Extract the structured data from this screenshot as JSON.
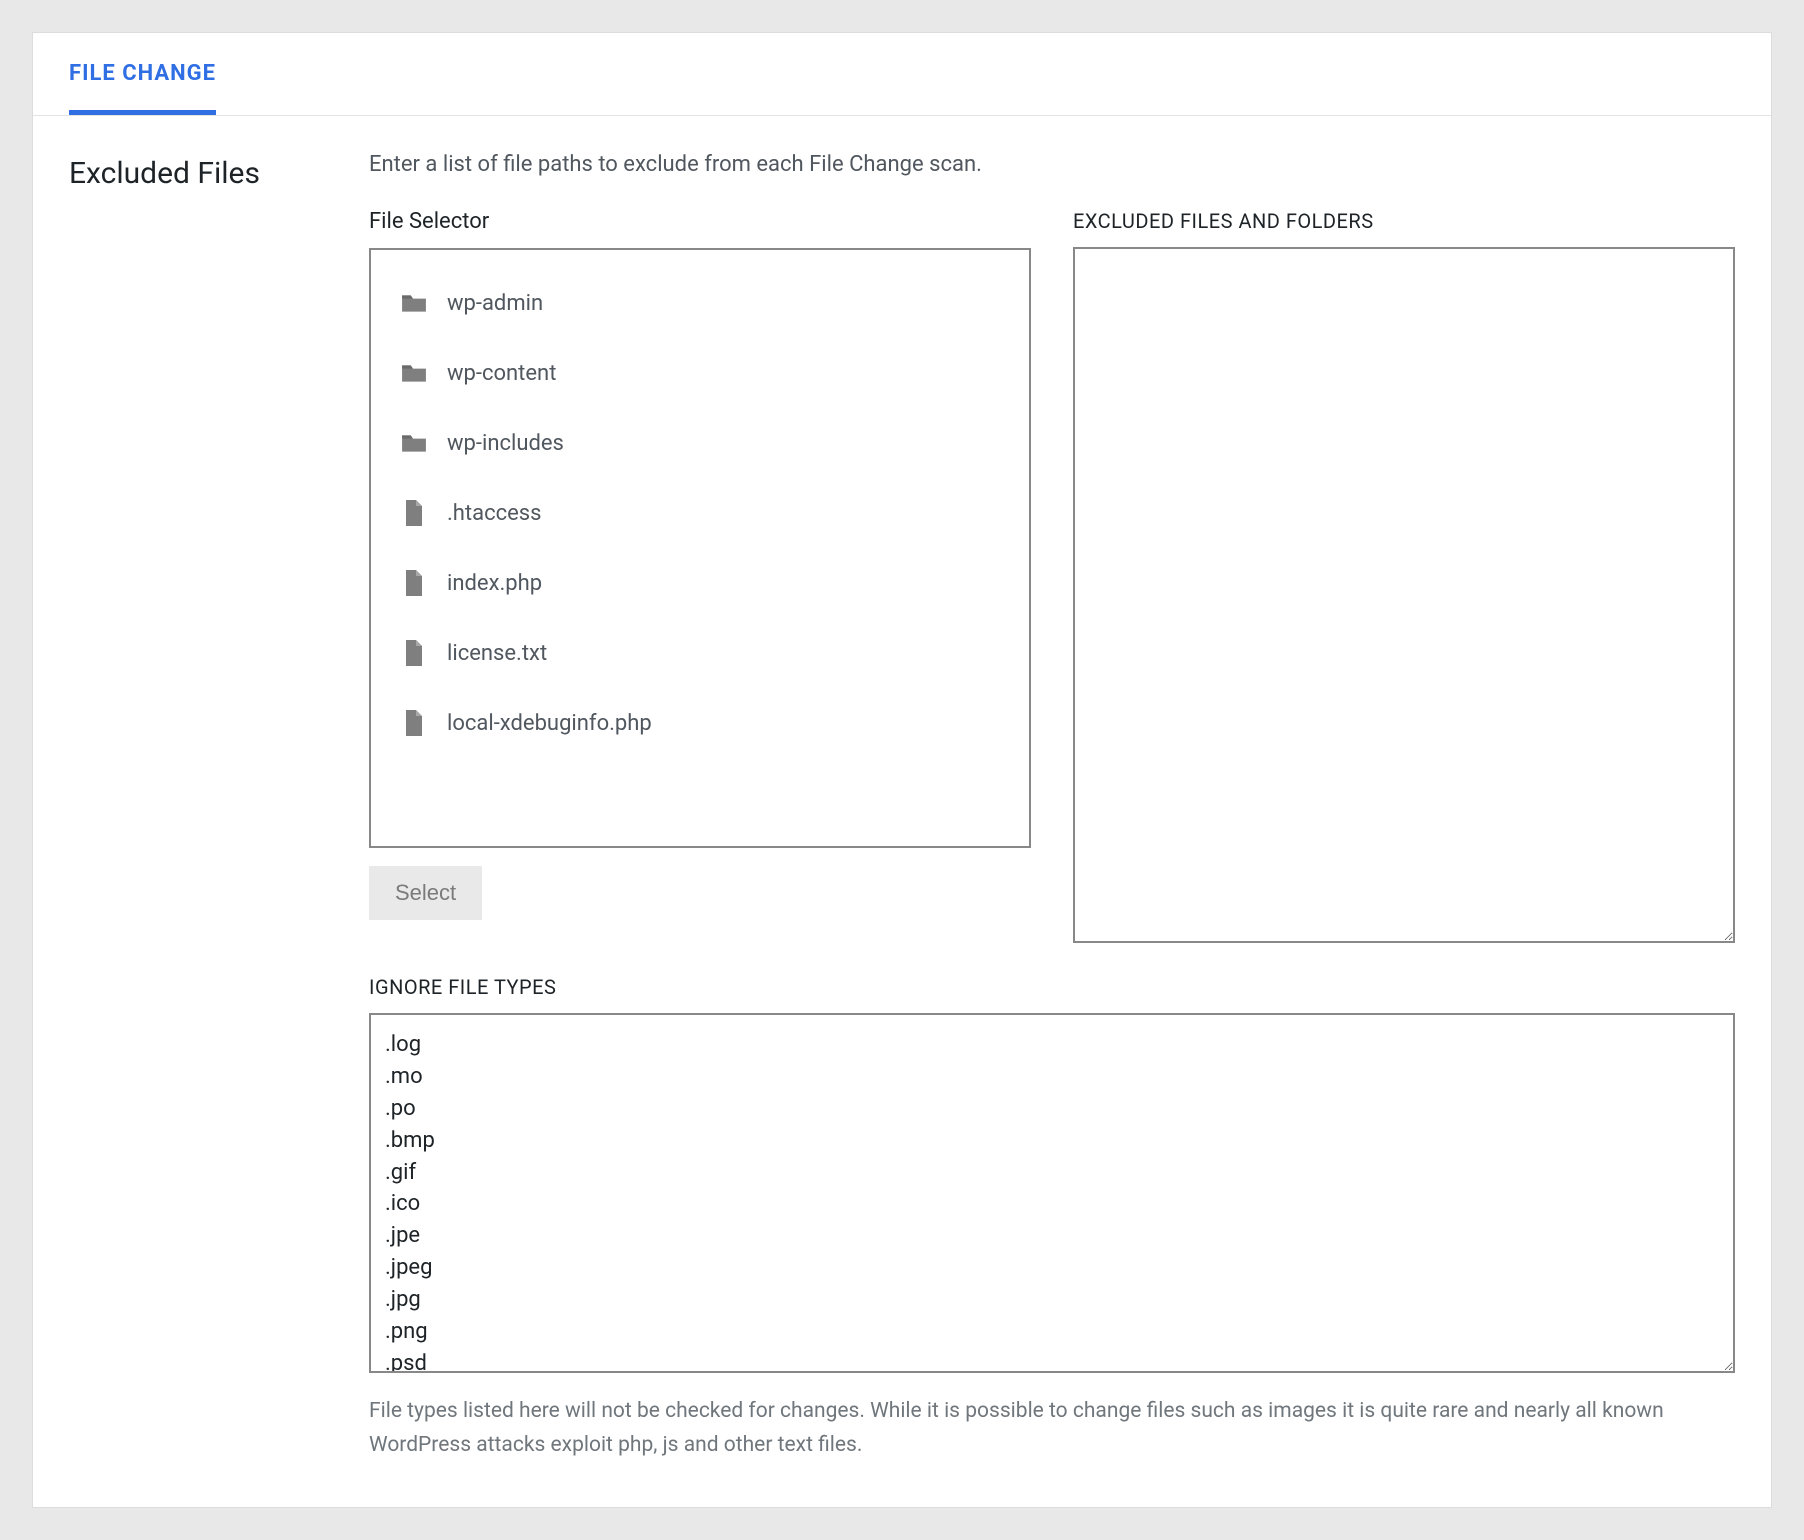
{
  "tab_label": "FILE CHANGE",
  "section_title": "Excluded Files",
  "description": "Enter a list of file paths to exclude from each File Change scan.",
  "file_selector_label": "File Selector",
  "excluded_label": "EXCLUDED FILES AND FOLDERS",
  "select_button_label": "Select",
  "files": [
    {
      "type": "folder",
      "name": "wp-admin"
    },
    {
      "type": "folder",
      "name": "wp-content"
    },
    {
      "type": "folder",
      "name": "wp-includes"
    },
    {
      "type": "file",
      "name": ".htaccess"
    },
    {
      "type": "file",
      "name": "index.php"
    },
    {
      "type": "file",
      "name": "license.txt"
    },
    {
      "type": "file",
      "name": "local-xdebuginfo.php"
    }
  ],
  "excluded_value": "",
  "ignore_types_label": "IGNORE FILE TYPES",
  "ignore_types_value": ".log\n.mo\n.po\n.bmp\n.gif\n.ico\n.jpe\n.jpeg\n.jpg\n.png\n.psd",
  "ignore_types_help": "File types listed here will not be checked for changes. While it is possible to change files such as images it is quite rare and nearly all known WordPress attacks exploit php, js and other text files."
}
